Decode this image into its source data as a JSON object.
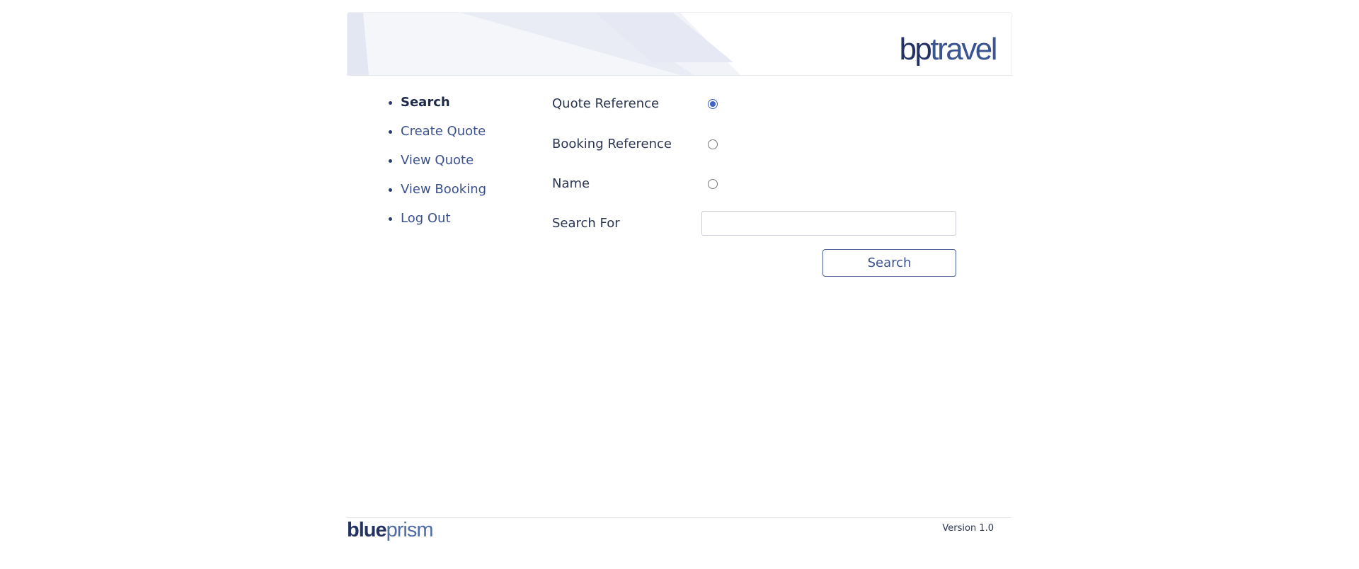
{
  "header": {
    "logo_part1": "bp",
    "logo_part2": "travel"
  },
  "nav": {
    "items": [
      {
        "label": "Search",
        "active": true
      },
      {
        "label": "Create Quote",
        "active": false
      },
      {
        "label": "View Quote",
        "active": false
      },
      {
        "label": "View Booking",
        "active": false
      },
      {
        "label": "Log Out",
        "active": false
      }
    ]
  },
  "form": {
    "quote_reference_label": "Quote Reference",
    "booking_reference_label": "Booking Reference",
    "name_label": "Name",
    "search_for_label": "Search For",
    "search_for_value": "",
    "selected_option": "Quote Reference",
    "search_button_label": "Search"
  },
  "footer": {
    "logo_part1": "blue",
    "logo_part2": "prism",
    "version": "Version 1.0"
  },
  "colors": {
    "brand_dark": "#233263",
    "brand_link": "#3c5290",
    "radio_accent": "#3f63c8"
  }
}
